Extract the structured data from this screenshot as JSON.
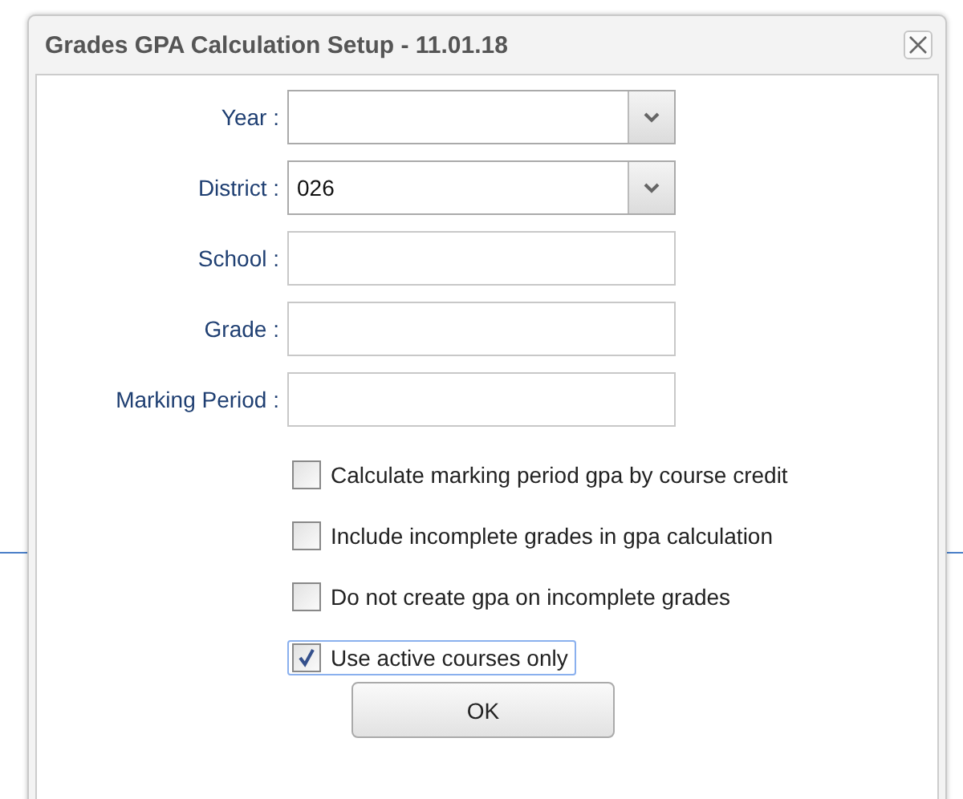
{
  "dialog": {
    "title": "Grades GPA Calculation Setup - 11.01.18"
  },
  "fields": [
    {
      "label": "Year :",
      "kind": "select"
    },
    {
      "label": "District :",
      "kind": "select",
      "value": "026"
    },
    {
      "label": "School :",
      "kind": "text"
    },
    {
      "label": "Grade :",
      "kind": "text"
    },
    {
      "label": "Marking Period :",
      "kind": "text"
    }
  ],
  "options": [
    {
      "label": "Calculate marking period gpa by course credit",
      "checked": false,
      "focused": false
    },
    {
      "label": "Include incomplete grades in gpa calculation",
      "checked": false,
      "focused": false
    },
    {
      "label": "Do not create gpa on incomplete grades",
      "checked": false,
      "focused": false
    },
    {
      "label": "Use active courses only",
      "checked": true,
      "focused": true
    }
  ],
  "buttons": [
    "OK"
  ]
}
